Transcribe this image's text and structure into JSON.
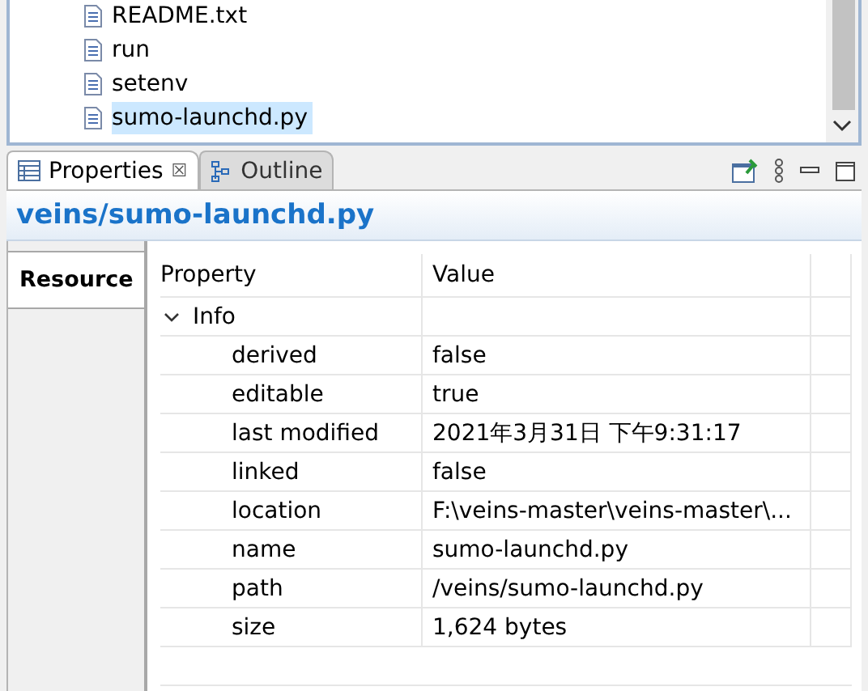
{
  "tree": {
    "items": [
      {
        "label": "README.txt",
        "selected": false
      },
      {
        "label": "run",
        "selected": false
      },
      {
        "label": "setenv",
        "selected": false
      },
      {
        "label": "sumo-launchd.py",
        "selected": true
      }
    ]
  },
  "view_tabs": [
    {
      "label": "Properties",
      "selected": true,
      "close": "☒"
    },
    {
      "label": "Outline",
      "selected": false
    }
  ],
  "title": "veins/sumo-launchd.py",
  "side_tabs": [
    {
      "label": "Resource",
      "selected": true
    }
  ],
  "table": {
    "columns": [
      "Property",
      "Value"
    ],
    "category": {
      "label": "Info",
      "expanded": true
    },
    "rows": [
      {
        "property": "derived",
        "value": "false"
      },
      {
        "property": "editable",
        "value": "true"
      },
      {
        "property": "last modified",
        "value": "2021年3月31日 下午9:31:17"
      },
      {
        "property": "linked",
        "value": "false"
      },
      {
        "property": "location",
        "value": "F:\\veins-master\\veins-master\\..."
      },
      {
        "property": "name",
        "value": "sumo-launchd.py"
      },
      {
        "property": "path",
        "value": "/veins/sumo-launchd.py"
      },
      {
        "property": "size",
        "value": "1,624  bytes"
      }
    ]
  }
}
